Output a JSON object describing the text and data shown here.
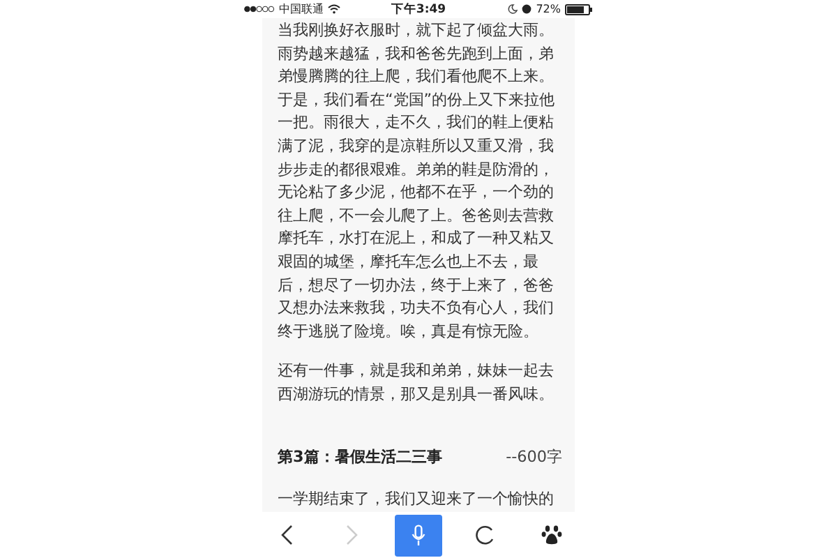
{
  "status_bar": {
    "carrier": "中国联通",
    "time": "下午3:49",
    "battery": "72%"
  },
  "article": [
    {
      "kind": "paragraph",
      "text": "当我刚换好衣服时，就下起了倾盆大雨。雨势越来越猛，我和爸爸先跑到上面，弟弟慢腾腾的往上爬，我们看他爬不上来。于是，我们看在“党国”的份上又下来拉他一把。雨很大，走不久，我们的鞋上便粘满了泥，我穿的是凉鞋所以又重又滑，我步步走的都很艰难。弟弟的鞋是防滑的，无论粘了多少泥，他都不在乎，一个劲的往上爬，不一会儿爬了上。爸爸则去营救摩托车，水打在泥上，和成了一种又粘又艰固的城堡，摩托车怎么也上不去，最后，想尽了一切办法，终于上来了，爸爸又想办法来救我，功夫不负有心人，我们终于逃脱了险境。唉，真是有惊无险。"
    },
    {
      "kind": "paragraph",
      "text": "还有一件事，就是我和弟弟，妹妹一起去西湖游玩的情景，那又是别具一番风味。"
    },
    {
      "kind": "heading",
      "text": "第3篇：暑假生活二三事",
      "note": "--600字"
    },
    {
      "kind": "paragraph",
      "text": "一学期结束了，我们又迎来了一个愉快的"
    }
  ],
  "toolbar": [
    {
      "kind": "back",
      "disabled": false
    },
    {
      "kind": "forward",
      "disabled": true
    },
    {
      "kind": "voice",
      "disabled": false
    },
    {
      "kind": "refresh",
      "disabled": false
    },
    {
      "kind": "paw",
      "disabled": false
    }
  ]
}
